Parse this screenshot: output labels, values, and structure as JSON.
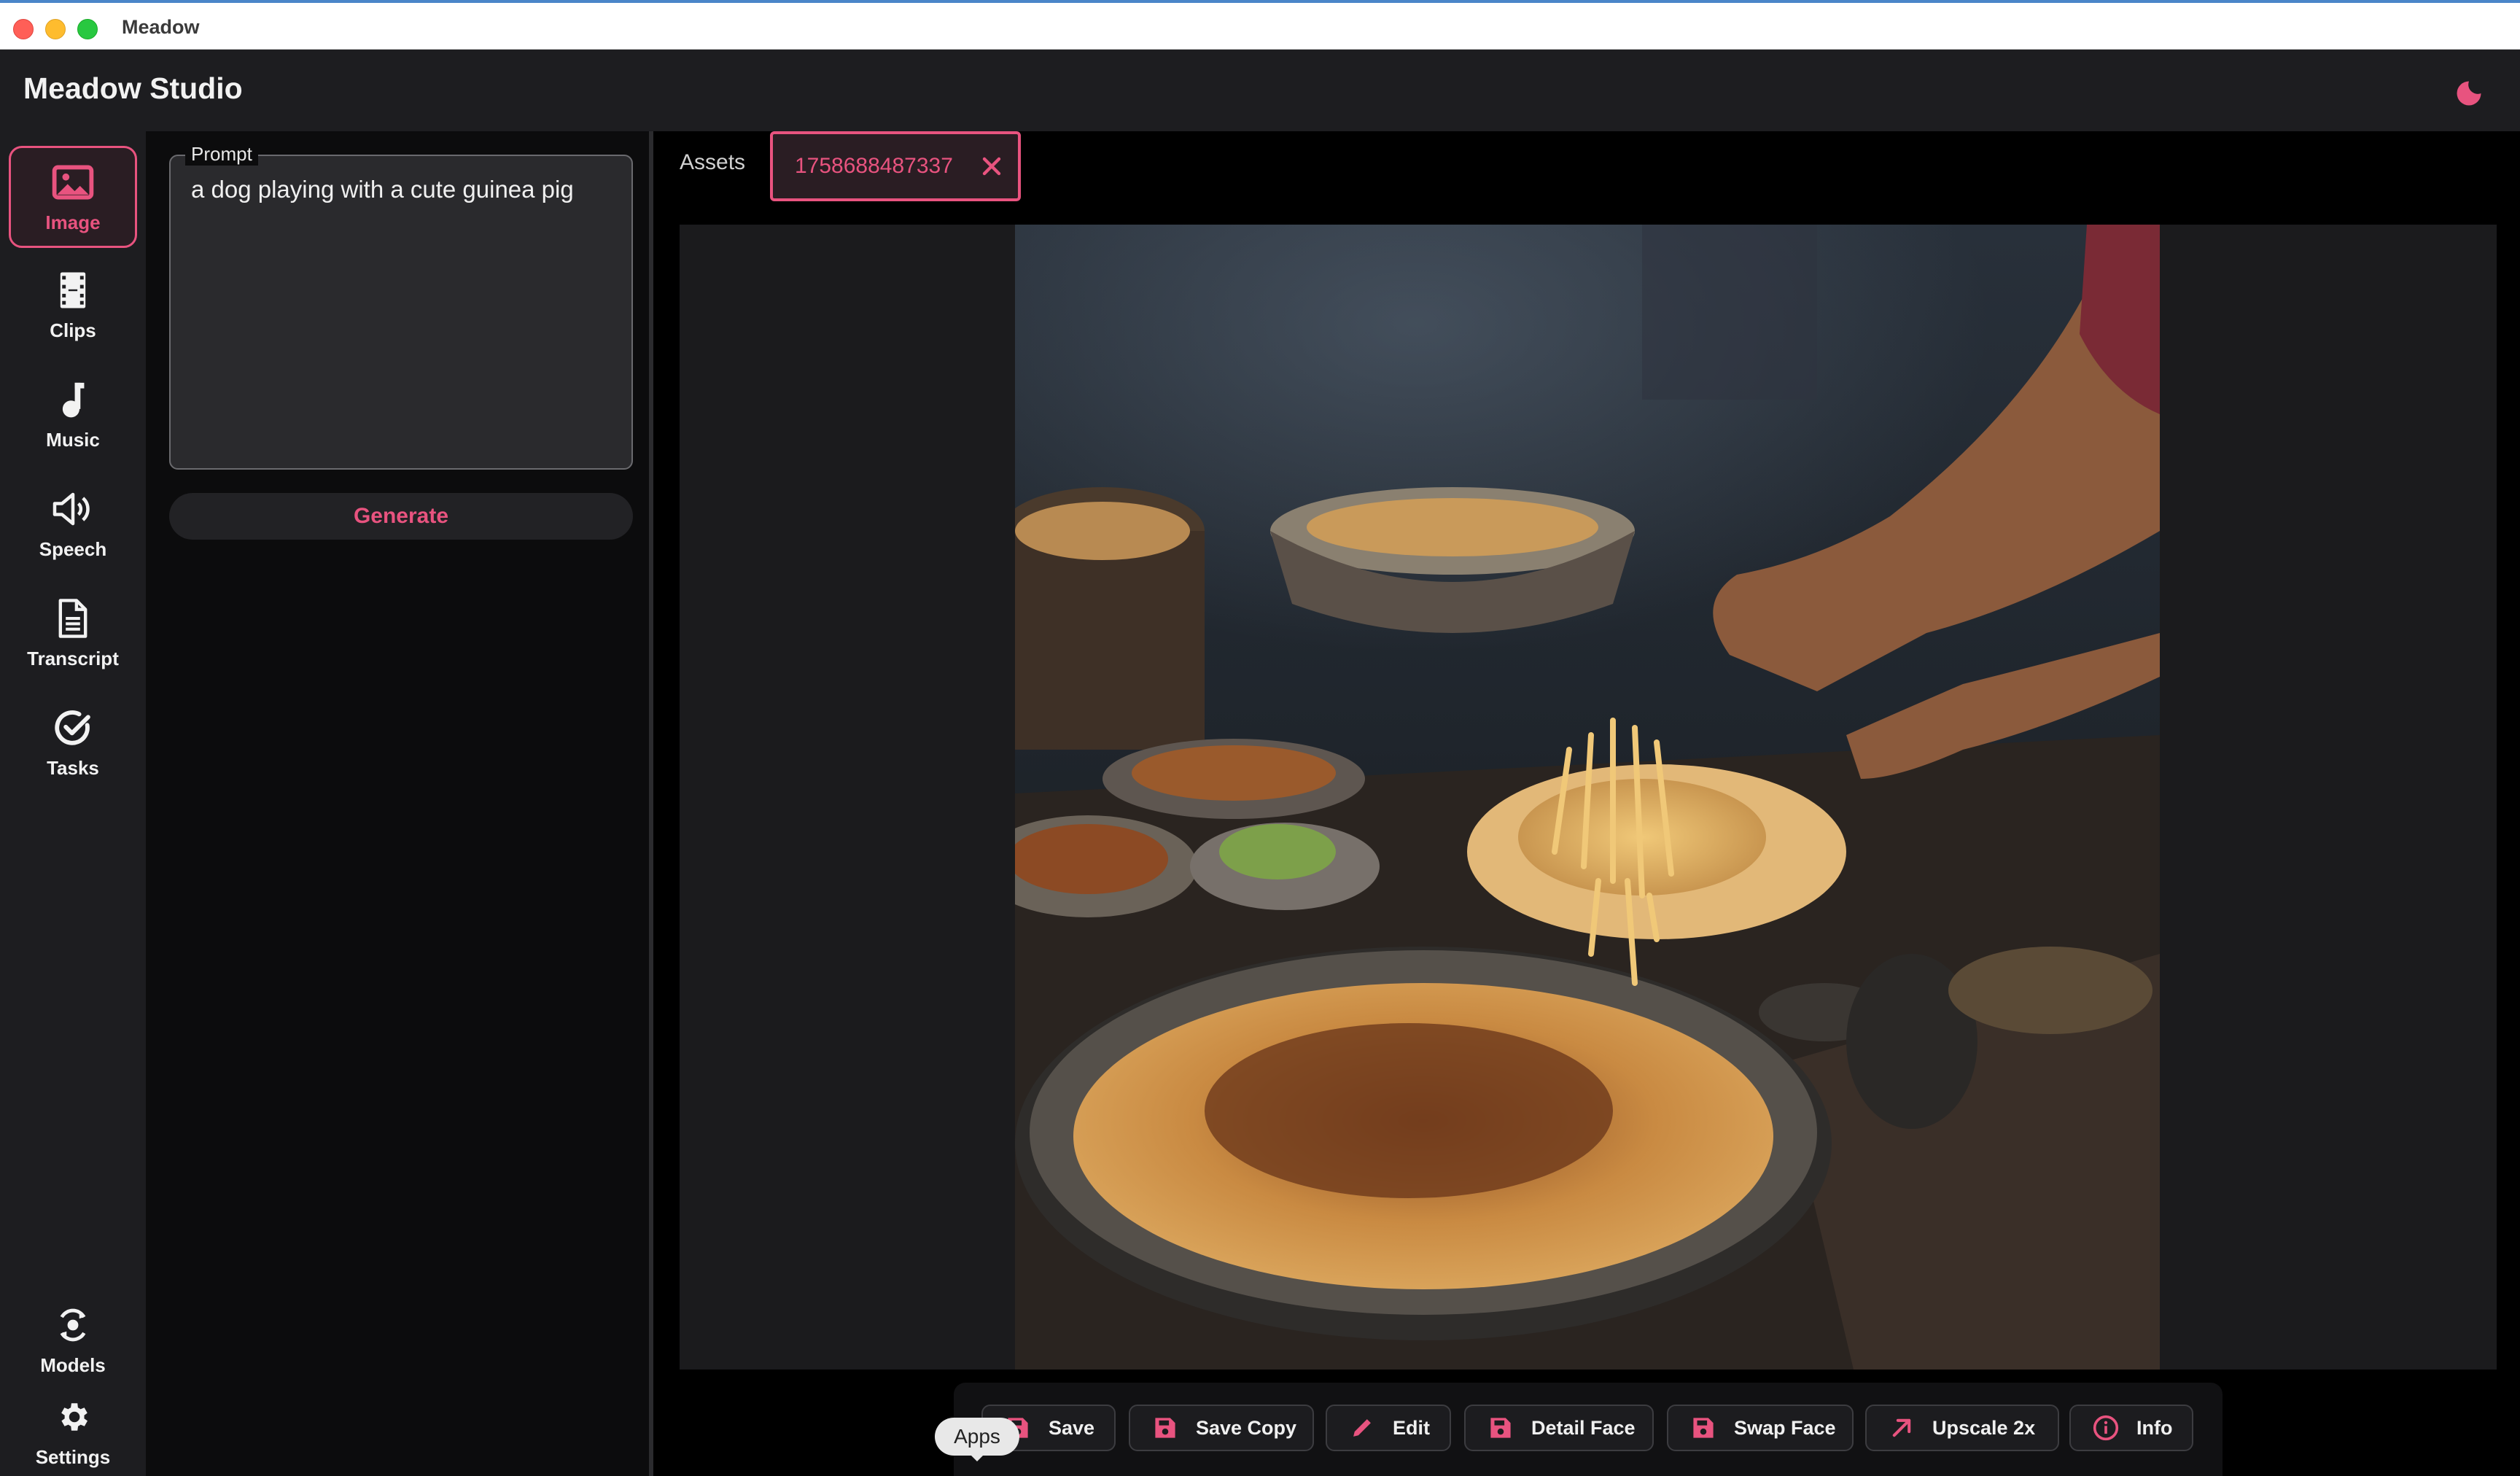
{
  "window": {
    "title": "Meadow"
  },
  "app": {
    "title": "Meadow Studio"
  },
  "nav": {
    "items": [
      {
        "label": "Image",
        "icon": "image-icon",
        "active": true
      },
      {
        "label": "Clips",
        "icon": "film-icon"
      },
      {
        "label": "Music",
        "icon": "music-note-icon"
      },
      {
        "label": "Speech",
        "icon": "speaker-icon"
      },
      {
        "label": "Transcript",
        "icon": "document-icon"
      },
      {
        "label": "Tasks",
        "icon": "check-circle-icon"
      }
    ],
    "bottom": [
      {
        "label": "Models",
        "icon": "models-icon"
      },
      {
        "label": "Settings",
        "icon": "gear-icon"
      }
    ]
  },
  "prompt": {
    "label": "Prompt",
    "value": "a dog playing with a cute guinea pig",
    "generate_label": "Generate"
  },
  "tabs": {
    "assets_label": "Assets",
    "active_file": "1758688487337"
  },
  "toolbar": {
    "buttons": [
      {
        "label": "Save",
        "icon": "save-icon"
      },
      {
        "label": "Save Copy",
        "icon": "save-icon"
      },
      {
        "label": "Edit",
        "icon": "pencil-icon"
      },
      {
        "label": "Detail Face",
        "icon": "save-icon"
      },
      {
        "label": "Swap Face",
        "icon": "save-icon"
      },
      {
        "label": "Upscale 2x",
        "icon": "arrow-up-right-icon"
      },
      {
        "label": "Info",
        "icon": "info-icon"
      }
    ],
    "tooltip": "Apps"
  },
  "colors": {
    "accent": "#e8537f",
    "background": "#000000",
    "panel": "#1d1d20"
  }
}
